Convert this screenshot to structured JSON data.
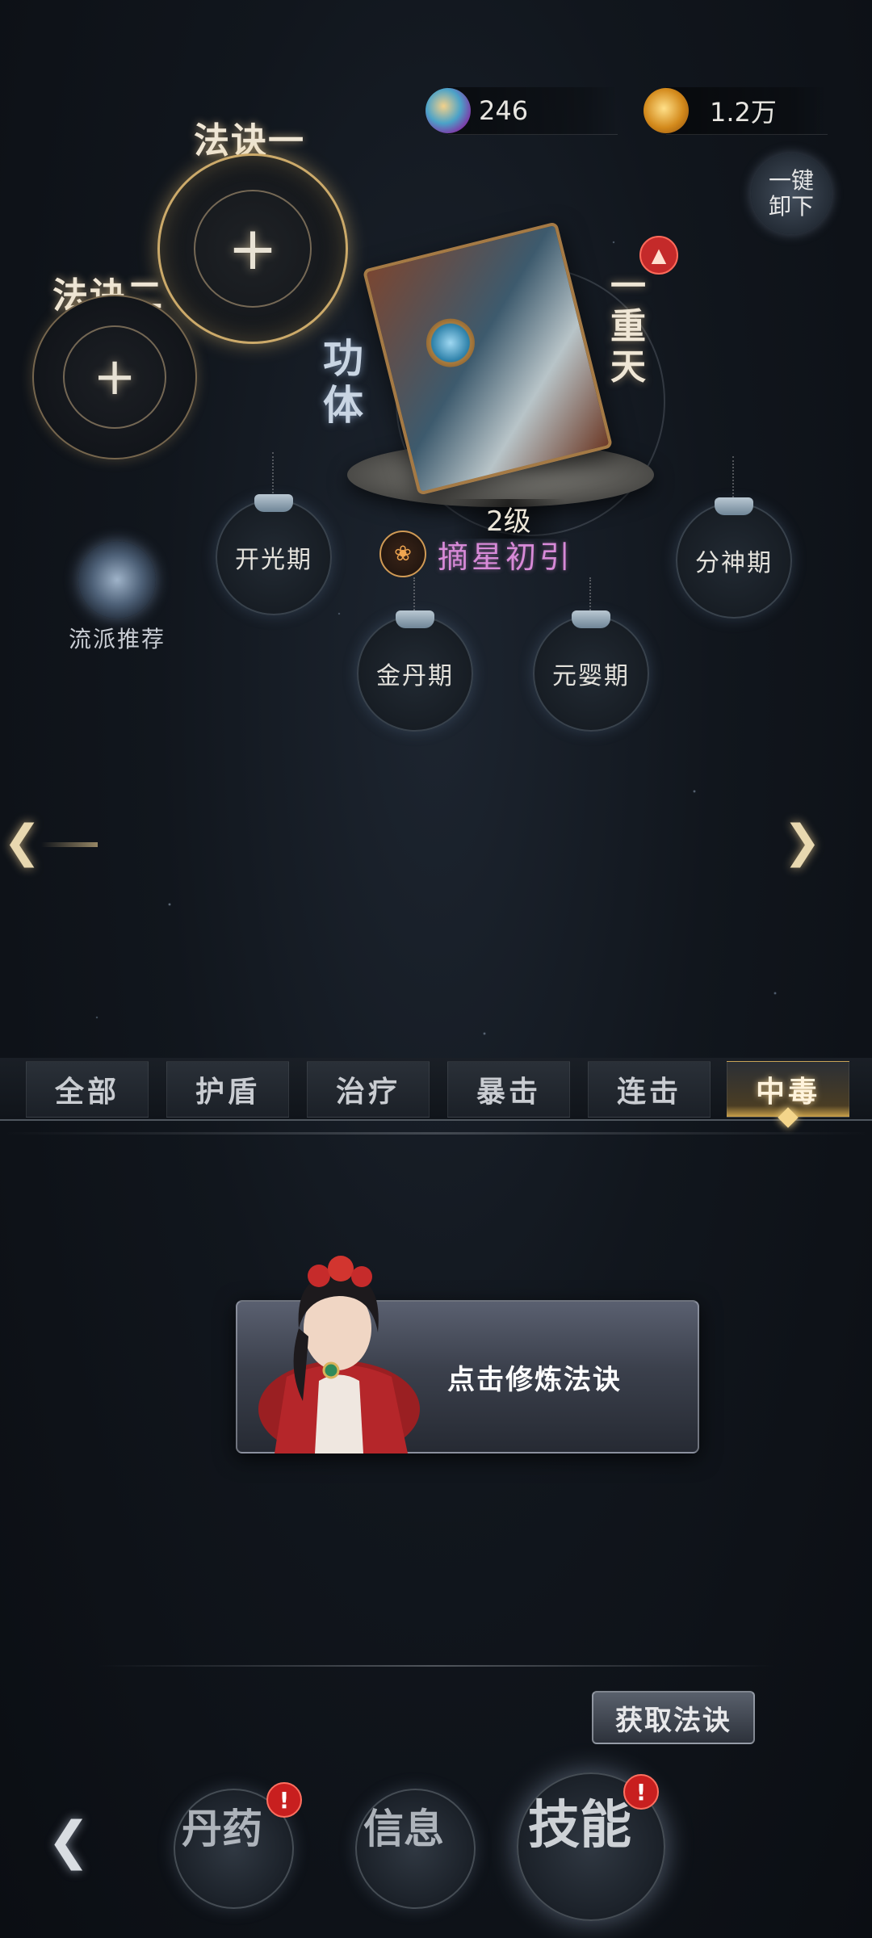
{
  "resources": {
    "potion_value": "246",
    "coin_value": "1.2万"
  },
  "unload_button": "一键卸下",
  "slots": {
    "slot1_label": "法诀一",
    "slot2_label": "法诀二",
    "add_symbol": "+"
  },
  "gongfa": {
    "type_label": "功体",
    "realm_label": "一重天",
    "level": "2级",
    "skill_name": "摘星初引"
  },
  "stages": {
    "kaiguang": "开光期",
    "jindan": "金丹期",
    "yuanying": "元婴期",
    "fenshen": "分神期"
  },
  "school_recommend": "流派推荐",
  "tabs": [
    "全部",
    "护盾",
    "治疗",
    "暴击",
    "连击",
    "中毒"
  ],
  "active_tab": "中毒",
  "practice_card": {
    "text": "点击修炼法诀"
  },
  "obtain_button": "获取法诀",
  "bottom_nav": {
    "back_icon": "back-arrow-icon",
    "danyao": "丹药",
    "xinxi": "信息",
    "jineng": "技能",
    "alert_mark": "!"
  },
  "colors": {
    "skill_name": "#d88ad8",
    "active_tab_glow": "#f4d58a",
    "alert": "#c81f1f"
  }
}
